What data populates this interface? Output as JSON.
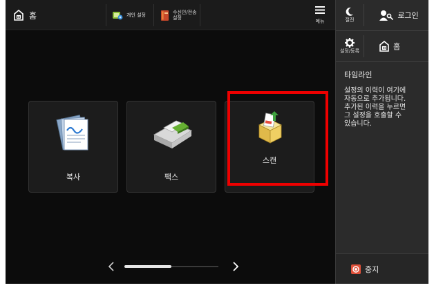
{
  "topbar": {
    "home_label": "홈",
    "personal_settings_label": "개인 설정",
    "recv_send_label_line1": "수신인/전송",
    "recv_send_label_line2": "설정",
    "menu_label": "메뉴"
  },
  "tiles": [
    {
      "id": "copy",
      "label": "복사"
    },
    {
      "id": "fax",
      "label": "팩스"
    },
    {
      "id": "scan",
      "label": "스캔"
    }
  ],
  "right_panel": {
    "power_save_label": "절전",
    "login_label": "로그인",
    "settings_label": "설정/등록",
    "home_label": "홈",
    "timeline_title": "타임라인",
    "timeline_text": "설정의 이력이 여기에\n자동으로 추가됩니다.\n추가된 이력을 누르면\n그 설정을 호출할 수\n있습니다.",
    "stop_label": "중지"
  },
  "colors": {
    "highlight": "#ee0000",
    "stop_icon": "#e0513a",
    "background": "#000000"
  },
  "icons": {
    "home": "home-icon",
    "personal_settings": "personal-settings-icon",
    "recv_send": "book-icon",
    "menu": "hamburger-menu-icon",
    "power_save": "moon-icon",
    "login": "user-key-icon",
    "settings": "gear-icon",
    "copy": "copy-documents-icon",
    "fax": "fax-machine-icon",
    "scan": "scan-box-icon",
    "stop": "stop-icon",
    "prev": "chevron-left-icon",
    "next": "chevron-right-icon"
  },
  "pager": {
    "current_page": 1,
    "total_pages": 2
  }
}
